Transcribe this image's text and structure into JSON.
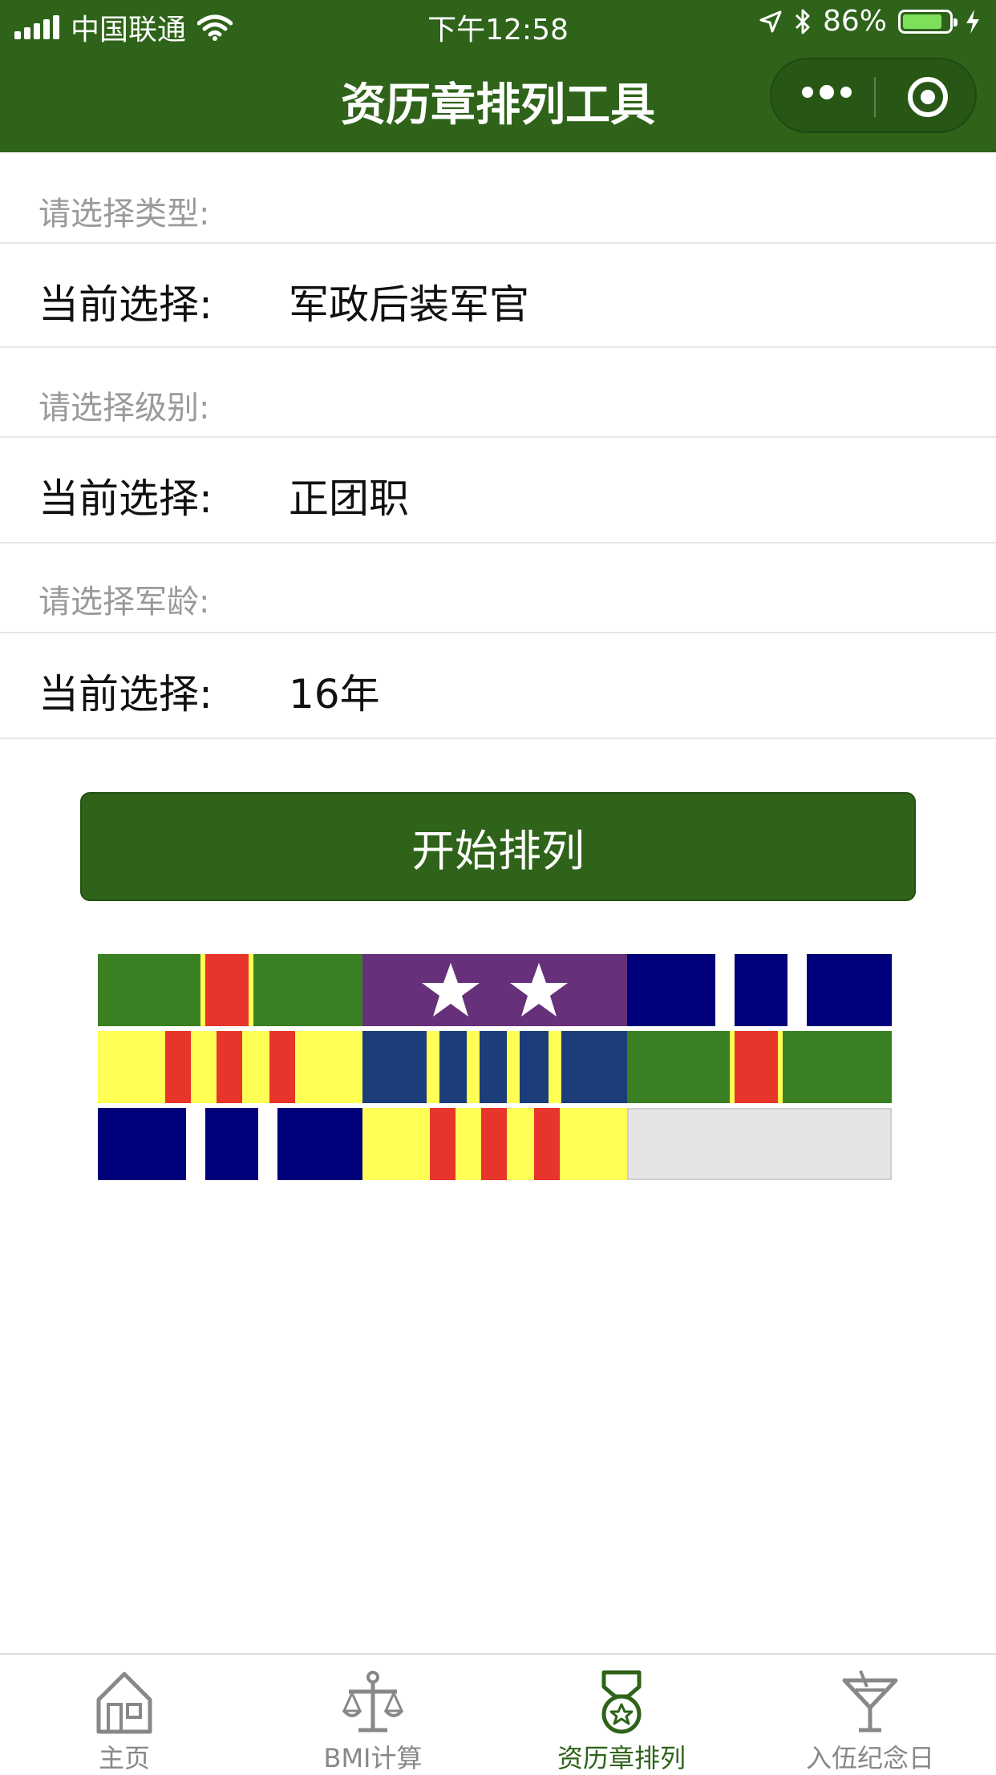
{
  "status_bar": {
    "carrier": "中国联通",
    "time": "下午12:58",
    "battery": "86%",
    "battery_level": 0.86
  },
  "nav": {
    "title": "资历章排列工具"
  },
  "form": {
    "type_prompt": "请选择类型:",
    "type_label": "当前选择:",
    "type_value": "军政后装军官",
    "level_prompt": "请选择级别:",
    "level_label": "当前选择:",
    "level_value": "正团职",
    "years_prompt": "请选择军龄:",
    "years_label": "当前选择:",
    "years_value": "16年"
  },
  "start_button": "开始排列",
  "ribbon_colors": {
    "green": "#3a8022",
    "red": "#e8352b",
    "yellow": "#ffff55",
    "purple": "#66307a",
    "navy": "#00007a",
    "blue": "#1b3d7a",
    "empty": "#e4e4e4",
    "white": "#ffffff"
  },
  "ribbons": [
    "green-red-center",
    "purple-two-stars",
    "navy-white-stripes",
    "yellow-red-stripes",
    "blue-yellow-stripes",
    "green-red-center",
    "navy-white-stripes",
    "yellow-red-stripes",
    "empty"
  ],
  "tabbar": {
    "items": [
      {
        "label": "主页",
        "icon": "house-icon",
        "active": false
      },
      {
        "label": "BMI计算",
        "icon": "scale-icon",
        "active": false
      },
      {
        "label": "资历章排列",
        "icon": "medal-icon",
        "active": true
      },
      {
        "label": "入伍纪念日",
        "icon": "cocktail-icon",
        "active": false
      }
    ],
    "active_color": "#2e6319",
    "inactive_color": "#888888"
  }
}
